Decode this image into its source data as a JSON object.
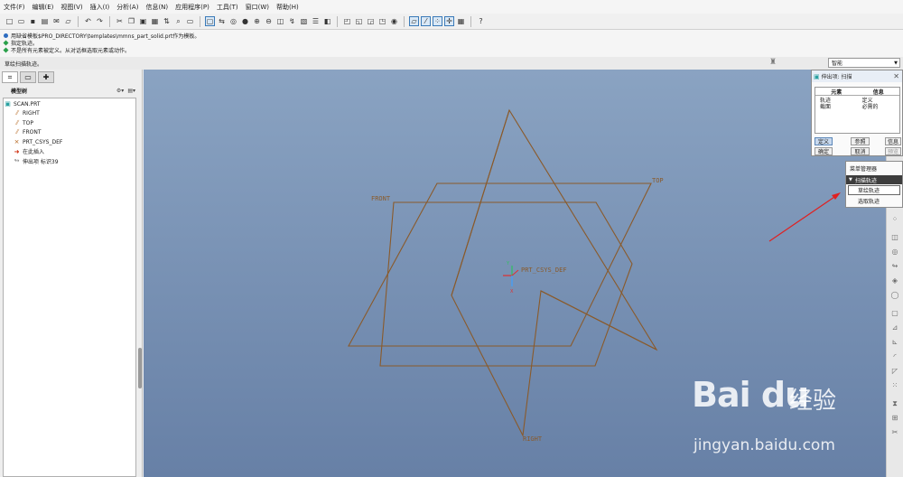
{
  "menu": [
    "文件(F)",
    "编辑(E)",
    "视图(V)",
    "插入(I)",
    "分析(A)",
    "信息(N)",
    "应用程序(P)",
    "工具(T)",
    "窗口(W)",
    "帮助(H)"
  ],
  "messages": [
    {
      "text": "用缺省模板$PRO_DIRECTORY\\templates\\mmns_part_solid.prt作为模板。",
      "type": "info"
    },
    {
      "text": "指定轨迹。",
      "type": "prompt"
    },
    {
      "text": "不是所有元素被定义。从对话框选取元素或动作。",
      "type": "prompt"
    }
  ],
  "status_text": "草绘扫描轨迹。",
  "filter": {
    "value": "智能"
  },
  "left_panel": {
    "title": "模型树",
    "tree": [
      {
        "label": "SCAN.PRT",
        "icon": "part-icon"
      },
      {
        "label": "RIGHT",
        "icon": "datum-plane-icon"
      },
      {
        "label": "TOP",
        "icon": "datum-plane-icon"
      },
      {
        "label": "FRONT",
        "icon": "datum-plane-icon"
      },
      {
        "label": "PRT_CSYS_DEF",
        "icon": "csys-icon"
      },
      {
        "label": "在此插入",
        "icon": "insert-here-icon"
      },
      {
        "label": "伸出项 标识39",
        "icon": "sweep-feature-icon"
      }
    ]
  },
  "viewport": {
    "labels": {
      "front": "FRONT",
      "top": "TOP",
      "right": "RIGHT",
      "csys": "PRT_CSYS_DEF",
      "csys_x": "X",
      "csys_y": "Y"
    },
    "colors": {
      "datum": "#8a5a2a",
      "axis_x": "#e03030",
      "axis_y": "#30c060",
      "axis_z": "#40a0ff"
    }
  },
  "dialog": {
    "title": "伸出项: 扫描",
    "col_element": "元素",
    "col_info": "信息",
    "rows": [
      {
        "element": "轨迹",
        "info": "定义"
      },
      {
        "element": "截面",
        "info": "必需的"
      }
    ],
    "buttons": {
      "define": "定义",
      "reference": "参照",
      "info": "信息",
      "ok": "确定",
      "cancel": "取消",
      "preview": "预览"
    }
  },
  "menu_manager": {
    "title": "菜单管理器",
    "section": "扫描轨迹",
    "items": [
      "草绘轨迹",
      "选取轨迹"
    ]
  },
  "watermark": {
    "logo": "Bai du",
    "brand_cn": "经验",
    "url": "jingyan.baidu.com"
  }
}
